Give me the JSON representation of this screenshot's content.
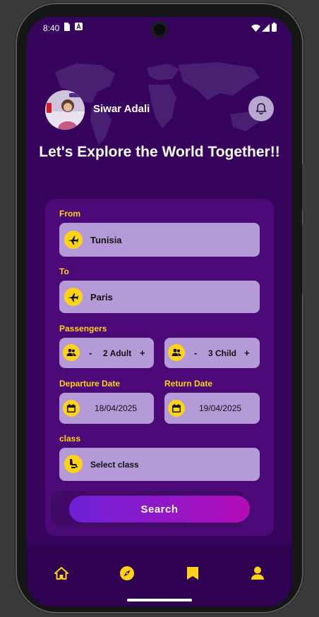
{
  "status_bar": {
    "time": "8:40"
  },
  "profile": {
    "name": "Siwar Adali"
  },
  "headline": "Let's Explore the World Together!!",
  "form": {
    "from_label": "From",
    "from_value": "Tunisia",
    "to_label": "To",
    "to_value": "Paris",
    "passengers_label": "Passengers",
    "adult_minus": "-",
    "adult_value": "2 Adult",
    "adult_plus": "+",
    "child_minus": "-",
    "child_value": "3 Child",
    "child_plus": "+",
    "departure_label": "Departure Date",
    "departure_value": "18/04/2025",
    "return_label": "Return Date",
    "return_value": "19/04/2025",
    "class_label": "class",
    "class_value": "Select class",
    "search_label": "Search"
  },
  "nav": {
    "items": [
      {
        "icon": "home-icon"
      },
      {
        "icon": "compass-icon"
      },
      {
        "icon": "bookmark-icon"
      },
      {
        "icon": "person-icon"
      }
    ],
    "accent": "#ffd21a"
  },
  "colors": {
    "background": "#36045c",
    "card": "#4b0a78",
    "field": "#b49ad6",
    "label": "#ffd21a",
    "search_gradient_start": "#6c22d8",
    "search_gradient_end": "#b40cb8"
  }
}
